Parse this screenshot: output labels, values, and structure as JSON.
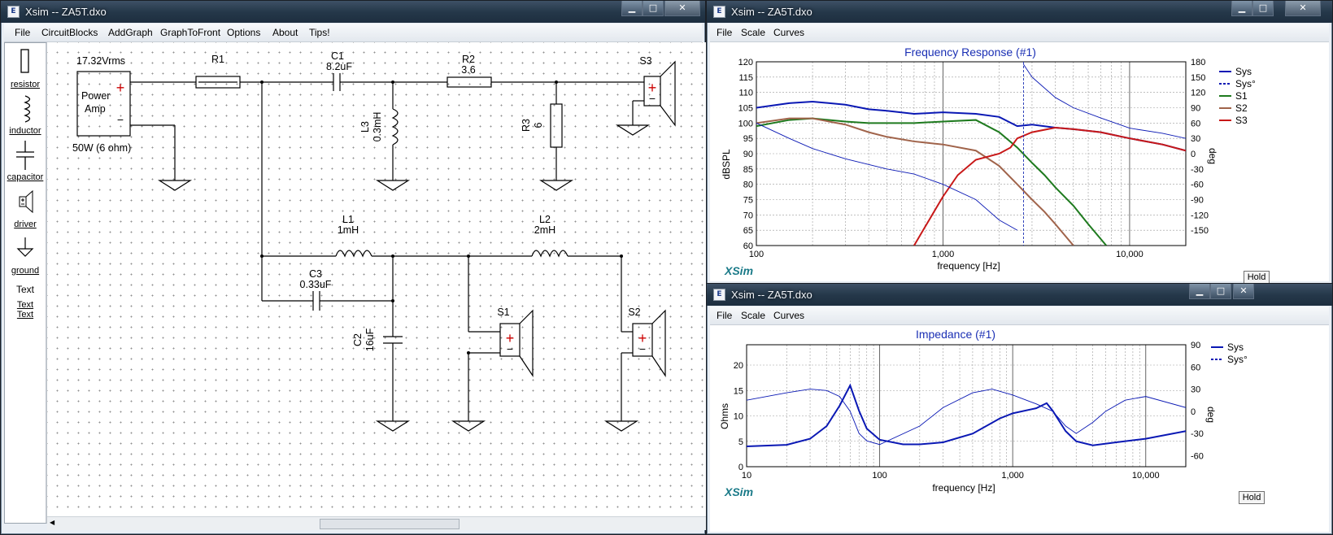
{
  "left_window": {
    "title": "Xsim -- ZA5T.dxo",
    "menu": [
      "File",
      "CircuitBlocks",
      "AddGraph",
      "GraphToFront",
      "Options",
      "About",
      "Tips!"
    ],
    "tools": [
      {
        "label": "resistor",
        "icon": "resistor-icon"
      },
      {
        "label": "inductor",
        "icon": "inductor-icon"
      },
      {
        "label": "capacitor",
        "icon": "capacitor-icon"
      },
      {
        "label": "driver",
        "icon": "driver-icon"
      },
      {
        "label": "ground",
        "icon": "ground-icon"
      },
      {
        "label": "Text",
        "icon": "text-icon"
      },
      {
        "label": "Text",
        "icon": ""
      }
    ],
    "schematic": {
      "amp": {
        "voltage": "17.32Vrms",
        "name_line1": "Power",
        "name_line2": "Amp",
        "rating": "50W (6 ohm)",
        "plus": "+",
        "minus": "−"
      },
      "R1": {
        "name": "R1"
      },
      "C1": {
        "name": "C1",
        "value": "8.2uF"
      },
      "R2": {
        "name": "R2",
        "value": "3.6"
      },
      "L3": {
        "name": "L3",
        "value": "0.3mH"
      },
      "R3": {
        "name": "R3",
        "value": "6"
      },
      "S3": {
        "name": "S3"
      },
      "L1": {
        "name": "L1",
        "value": "1mH"
      },
      "L2": {
        "name": "L2",
        "value": "2mH"
      },
      "C3": {
        "name": "C3",
        "value": "0.33uF"
      },
      "C2": {
        "name": "C2",
        "value": "16uF"
      },
      "S1": {
        "name": "S1"
      },
      "S2": {
        "name": "S2"
      }
    }
  },
  "freq_window": {
    "title": "Xsim -- ZA5T.dxo",
    "menu": [
      "File",
      "Scale",
      "Curves"
    ],
    "graph_title": "Frequency Response (#1)",
    "ylabel": "dBSPL",
    "y2label": "deg",
    "xlabel": "frequency [Hz]",
    "brand": "XSim",
    "hold": "Hold",
    "yticks": [
      "120",
      "115",
      "110",
      "105",
      "100",
      "95",
      "90",
      "85",
      "80",
      "75",
      "70",
      "65",
      "60"
    ],
    "y2ticks": [
      "180",
      "150",
      "120",
      "90",
      "60",
      "30",
      "0",
      "-30",
      "-60",
      "-90",
      "-120",
      "-150"
    ],
    "xticks": [
      "100",
      "1,000",
      "10,000"
    ],
    "legend": [
      {
        "name": "Sys",
        "color": "#0a18b4",
        "style": "solid"
      },
      {
        "name": "Sys°",
        "color": "#0a18b4",
        "style": "dashed"
      },
      {
        "name": "S1",
        "color": "#1e7a1e",
        "style": "solid"
      },
      {
        "name": "S2",
        "color": "#a0634a",
        "style": "solid"
      },
      {
        "name": "S3",
        "color": "#c81818",
        "style": "solid"
      }
    ]
  },
  "imp_window": {
    "title": "Xsim -- ZA5T.dxo",
    "menu": [
      "File",
      "Scale",
      "Curves"
    ],
    "graph_title": "Impedance (#1)",
    "ylabel": "Ohms",
    "y2label": "deg",
    "xlabel": "frequency [Hz]",
    "brand": "XSim",
    "hold": "Hold",
    "yticks": [
      "20",
      "15",
      "10",
      "5",
      "0"
    ],
    "y2ticks": [
      "90",
      "60",
      "30",
      "0",
      "-30",
      "-60"
    ],
    "xticks": [
      "10",
      "100",
      "1,000",
      "10,000"
    ],
    "legend": [
      {
        "name": "Sys",
        "color": "#0a18b4",
        "style": "solid"
      },
      {
        "name": "Sys°",
        "color": "#0a18b4",
        "style": "dashed"
      }
    ]
  },
  "chart_data": [
    {
      "type": "line",
      "title": "Frequency Response (#1)",
      "xlabel": "frequency [Hz]",
      "ylabel": "dBSPL",
      "y2label": "deg",
      "xscale": "log",
      "xlim": [
        100,
        20000
      ],
      "ylim": [
        60,
        120
      ],
      "y2lim": [
        -180,
        180
      ],
      "legend_position": "top-right",
      "series": [
        {
          "name": "Sys",
          "axis": "y",
          "x": [
            100,
            150,
            200,
            300,
            400,
            500,
            700,
            1000,
            1500,
            2000,
            2500,
            3000,
            4000,
            5000,
            7000,
            10000,
            15000,
            20000
          ],
          "y": [
            105,
            106.5,
            107,
            106,
            104.5,
            104,
            103,
            103.5,
            103,
            102,
            99,
            99.5,
            98.5,
            98,
            97,
            95,
            93,
            91
          ]
        },
        {
          "name": "S1",
          "axis": "y",
          "x": [
            100,
            150,
            200,
            300,
            400,
            500,
            700,
            1000,
            1500,
            2000,
            2500,
            3000,
            3500,
            4000,
            5000,
            6000,
            7500
          ],
          "y": [
            99,
            101,
            101.5,
            100.5,
            100,
            100,
            100,
            100.5,
            101,
            97,
            92,
            87,
            83,
            79,
            73,
            67,
            60
          ]
        },
        {
          "name": "S2",
          "axis": "y",
          "x": [
            100,
            150,
            200,
            300,
            400,
            500,
            700,
            1000,
            1500,
            2000,
            2500,
            3000,
            3500,
            4000,
            5000
          ],
          "y": [
            100,
            101.5,
            101.5,
            99.5,
            97,
            95.5,
            94,
            93,
            91,
            86,
            80,
            75,
            71,
            67,
            60
          ]
        },
        {
          "name": "S3",
          "axis": "y",
          "x": [
            700,
            800,
            1000,
            1200,
            1500,
            2000,
            2300,
            2500,
            3000,
            4000,
            5000,
            7000,
            10000,
            15000,
            20000
          ],
          "y": [
            60,
            66,
            76,
            83,
            88,
            90,
            92,
            95,
            97,
            98.5,
            98,
            97,
            95,
            93,
            91
          ]
        },
        {
          "name": "Sys°",
          "axis": "y2",
          "x": [
            100,
            150,
            200,
            300,
            500,
            700,
            1000,
            1500,
            2000,
            2500,
            2700,
            3000,
            4000,
            5000,
            7000,
            10000,
            15000,
            20000
          ],
          "y": [
            60,
            30,
            10,
            -10,
            -30,
            -40,
            -60,
            -90,
            -130,
            -150,
            175,
            150,
            110,
            90,
            70,
            50,
            40,
            30
          ]
        }
      ]
    },
    {
      "type": "line",
      "title": "Impedance (#1)",
      "xlabel": "frequency [Hz]",
      "ylabel": "Ohms",
      "y2label": "deg",
      "xscale": "log",
      "xlim": [
        10,
        20000
      ],
      "ylim": [
        0,
        24
      ],
      "y2lim": [
        -75,
        90
      ],
      "legend_position": "top-right",
      "series": [
        {
          "name": "Sys",
          "axis": "y",
          "x": [
            10,
            20,
            30,
            40,
            50,
            60,
            70,
            80,
            100,
            150,
            200,
            300,
            500,
            800,
            1000,
            1500,
            1800,
            2000,
            2500,
            3000,
            4000,
            6000,
            10000,
            20000
          ],
          "y": [
            4,
            4.3,
            5.5,
            8,
            12,
            16,
            11,
            7.5,
            5.3,
            4.4,
            4.4,
            4.8,
            6.5,
            9.5,
            10.5,
            11.5,
            12.5,
            11,
            7,
            5,
            4.2,
            4.8,
            5.5,
            7
          ]
        },
        {
          "name": "Sys°",
          "axis": "y2",
          "x": [
            10,
            20,
            30,
            40,
            50,
            60,
            70,
            80,
            100,
            200,
            300,
            500,
            700,
            1000,
            1500,
            2000,
            2500,
            3000,
            4000,
            5000,
            7000,
            10000,
            20000
          ],
          "y": [
            15,
            25,
            30,
            28,
            20,
            0,
            -30,
            -40,
            -45,
            -20,
            5,
            25,
            30,
            22,
            10,
            0,
            -20,
            -30,
            -15,
            0,
            15,
            20,
            5
          ]
        }
      ]
    }
  ]
}
